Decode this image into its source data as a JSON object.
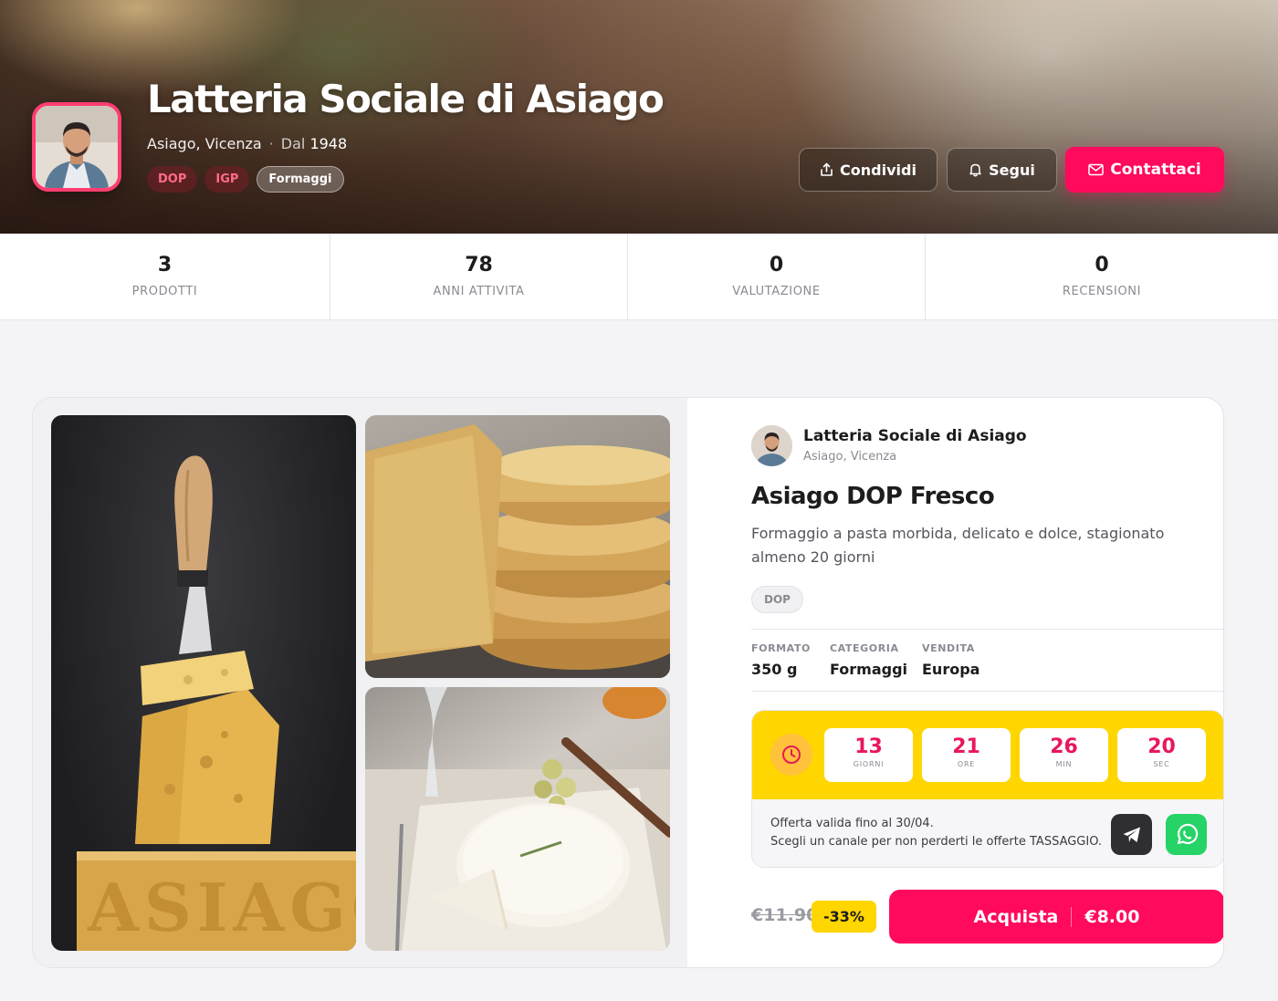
{
  "hero": {
    "title": "Latteria Sociale di Asiago",
    "location": "Asiago, Vicenza",
    "since_label": "Dal",
    "since_year": "1948",
    "tags": [
      "DOP",
      "IGP",
      "Formaggi"
    ],
    "share_label": "Condividi",
    "follow_label": "Segui",
    "contact_label": "Contattaci"
  },
  "stats": [
    {
      "value": "3",
      "label": "PRODOTTI"
    },
    {
      "value": "78",
      "label": "ANNI ATTIVITA"
    },
    {
      "value": "0",
      "label": "VALUTAZIONE"
    },
    {
      "value": "0",
      "label": "RECENSIONI"
    }
  ],
  "product": {
    "seller_name": "Latteria Sociale di Asiago",
    "seller_location": "Asiago, Vicenza",
    "title": "Asiago DOP Fresco",
    "description": "Formaggio a pasta morbida, delicato e dolce, stagionato almeno 20 giorni",
    "badge": "DOP",
    "specs": [
      {
        "key": "FORMATO",
        "value": "350 g"
      },
      {
        "key": "CATEGORIA",
        "value": "Formaggi"
      },
      {
        "key": "VENDITA",
        "value": "Europa"
      }
    ],
    "images_text": {
      "wheel_stamp": "ASIAGO"
    },
    "countdown": [
      {
        "value": "13",
        "unit": "GIORNI"
      },
      {
        "value": "21",
        "unit": "ORE"
      },
      {
        "value": "26",
        "unit": "MIN"
      },
      {
        "value": "20",
        "unit": "SEC"
      }
    ],
    "offer_line1": "Offerta valida fino al 30/04.",
    "offer_line2": "Scegli un canale per non perderti le offerte TASSAGGIO.",
    "old_price": "€11.90",
    "discount": "-33%",
    "buy_label": "Acquista",
    "buy_price": "€8.00"
  },
  "colors": {
    "accent": "#ff0a5c",
    "offer_yellow": "#ffd600",
    "whatsapp": "#25d366"
  },
  "icons": [
    "share-icon",
    "bell-icon",
    "mail-icon",
    "clock-icon",
    "telegram-icon",
    "whatsapp-icon"
  ]
}
